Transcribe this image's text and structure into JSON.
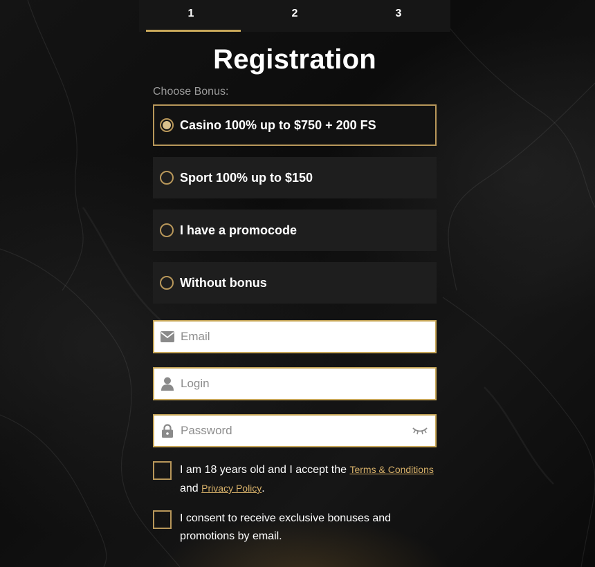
{
  "steps": [
    {
      "label": "1",
      "active": true
    },
    {
      "label": "2",
      "active": false
    },
    {
      "label": "3",
      "active": false
    }
  ],
  "title": "Registration",
  "choose_bonus_label": "Choose Bonus:",
  "bonuses": [
    {
      "label": "Casino 100% up to $750 + 200 FS",
      "selected": true
    },
    {
      "label": "Sport 100% up to $150",
      "selected": false
    },
    {
      "label": "I have a promocode",
      "selected": false
    },
    {
      "label": "Without bonus",
      "selected": false
    }
  ],
  "fields": {
    "email": {
      "placeholder": "Email",
      "value": "",
      "icon": "envelope-icon"
    },
    "login": {
      "placeholder": "Login",
      "value": "",
      "icon": "user-icon"
    },
    "password": {
      "placeholder": "Password",
      "value": "",
      "icon": "lock-icon",
      "toggle_icon": "eye-closed-icon"
    }
  },
  "consents": {
    "age": {
      "text_before": "I am 18 years old and I accept the",
      "terms_link": "Terms & Conditions",
      "text_mid": "and",
      "privacy_link": "Privacy Policy",
      "text_after": "."
    },
    "marketing": {
      "text": "I consent to receive exclusive bonuses and promotions by email."
    }
  },
  "colors": {
    "accent_gold": "#c9a85a",
    "link_gold": "#d9b26a",
    "option_bg": "#1e1e1e"
  }
}
